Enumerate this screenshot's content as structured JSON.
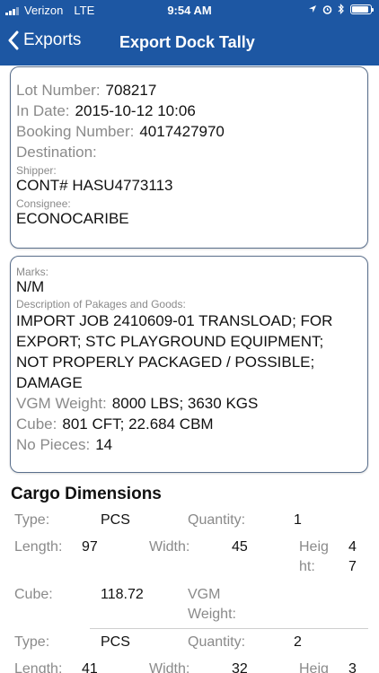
{
  "status_bar": {
    "carrier": "Verizon",
    "network": "LTE",
    "time": "9:54 AM",
    "icons": [
      "location-arrow-icon",
      "alarm-icon",
      "bluetooth-icon",
      "battery-icon"
    ],
    "battery_level": 0.9
  },
  "nav": {
    "back_label": "Exports",
    "title": "Export Dock Tally"
  },
  "lot_card": {
    "lot_number_label": "Lot Number:",
    "lot_number": "708217",
    "in_date_label": "In Date:",
    "in_date": "2015-10-12 10:06",
    "booking_number_label": "Booking Number:",
    "booking_number": "4017427970",
    "destination_label": "Destination:",
    "destination": "",
    "shipper_label": "Shipper:",
    "shipper": "CONT# HASU4773113",
    "consignee_label": "Consignee:",
    "consignee": "ECONOCARIBE"
  },
  "goods_card": {
    "marks_label": "Marks:",
    "marks": "N/M",
    "description_label": "Description of Pakages and Goods:",
    "description_lines": [
      "IMPORT JOB 2410609-01 TRANSLOAD; FOR",
      "EXPORT; STC PLAYGROUND EQUIPMENT;",
      "NOT PROPERLY PACKAGED / POSSIBLE;",
      "DAMAGE"
    ],
    "vgm_weight_label": "VGM Weight:",
    "vgm_weight": "8000 LBS; 3630 KGS",
    "cube_label": "Cube:",
    "cube": "801 CFT; 22.684 CBM",
    "no_pieces_label": "No Pieces:",
    "no_pieces": "14"
  },
  "cargo": {
    "section_title": "Cargo Dimensions",
    "type_label": "Type:",
    "quantity_label": "Quantity:",
    "length_label": "Length:",
    "width_label": "Width:",
    "height_label_lines": [
      "Heig",
      "ht:"
    ],
    "cube_label": "Cube:",
    "vgm_weight_label_lines": [
      "VGM",
      "Weight:"
    ],
    "items": [
      {
        "type": "PCS",
        "quantity": "1",
        "length": "97",
        "width": "45",
        "height_lines": [
          "4",
          "7"
        ],
        "cube": "118.72",
        "vgm_weight": ""
      },
      {
        "type": "PCS",
        "quantity": "2",
        "length": "41",
        "width": "32",
        "height_lines": [
          "3",
          ""
        ]
      }
    ]
  }
}
